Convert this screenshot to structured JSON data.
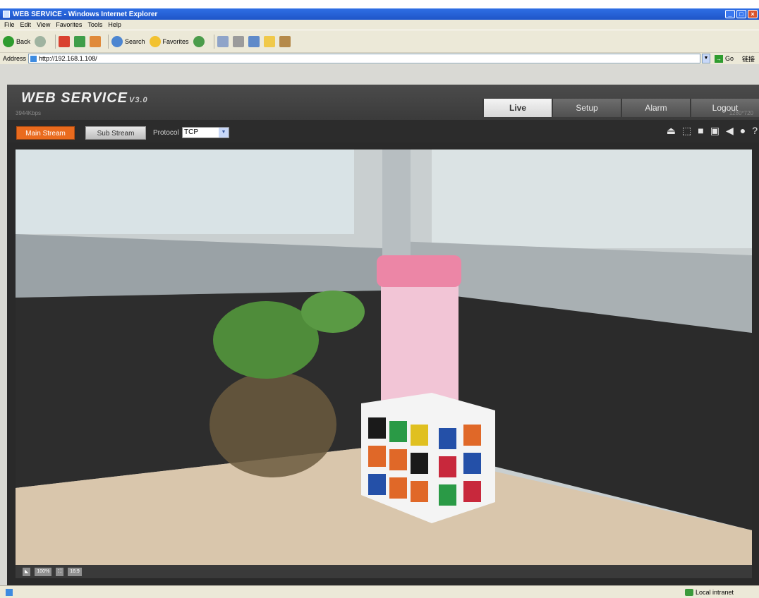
{
  "window": {
    "title": "WEB SERVICE - Windows Internet Explorer",
    "min_btn": "_",
    "max_btn": "□",
    "close_btn": "×"
  },
  "menu": [
    "File",
    "Edit",
    "View",
    "Favorites",
    "Tools",
    "Help"
  ],
  "toolbar": {
    "back": "Back",
    "search": "Search",
    "favorites": "Favorites"
  },
  "address": {
    "label": "Address",
    "url": "http://192.168.1.108/",
    "go": "Go",
    "links": "链接"
  },
  "app": {
    "brand": "WEB SERVICE",
    "version": "V3.0",
    "tabs": [
      {
        "label": "Live",
        "active": true
      },
      {
        "label": "Setup",
        "active": false
      },
      {
        "label": "Alarm",
        "active": false
      },
      {
        "label": "Logout",
        "active": false
      }
    ]
  },
  "controls": {
    "main_stream": "Main Stream",
    "sub_stream": "Sub Stream",
    "protocol_label": "Protocol",
    "protocol_value": "TCP",
    "bitrate": "3944Kbps",
    "resolution": "1280*720"
  },
  "tool_icons": [
    "eject-icon",
    "capture-icon",
    "snapshot-icon",
    "record-icon",
    "audio-icon",
    "microphone-icon",
    "help-icon"
  ],
  "video_bottom": {
    "zoom": "100%",
    "ratio": "16:9"
  },
  "status": {
    "zone": "Local intranet"
  },
  "colors": {
    "titlebar": "#1f55c8",
    "active_button": "#ea6b1e",
    "page_bg": "#2a2a2a"
  }
}
